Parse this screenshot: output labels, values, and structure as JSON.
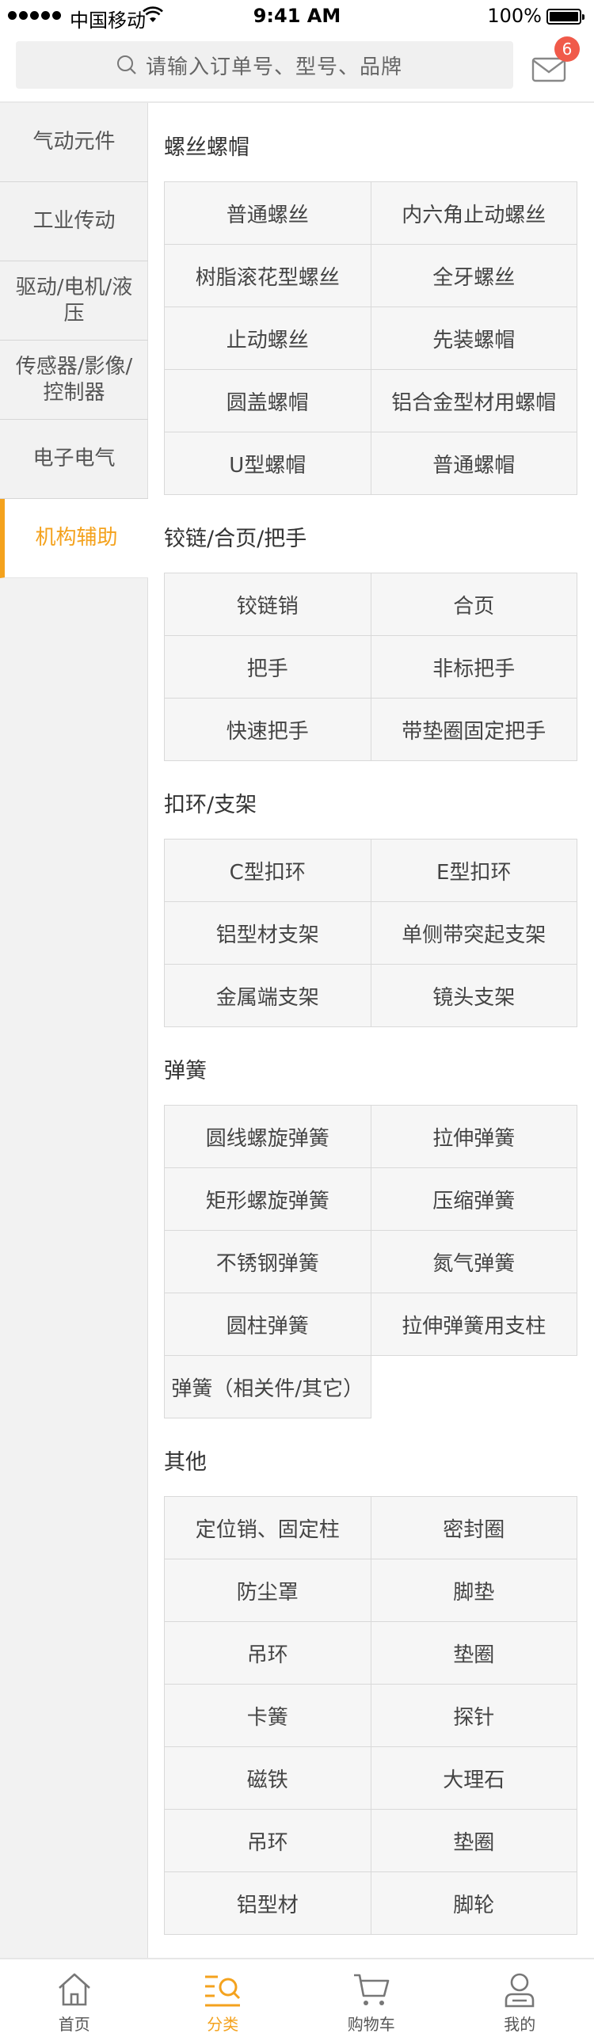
{
  "status_bar": {
    "carrier": "中国移动",
    "time": "9:41 AM",
    "battery": "100%"
  },
  "search": {
    "placeholder": "请输入订单号、型号、品牌",
    "badge_count": "6"
  },
  "sidebar": {
    "items": [
      {
        "label": "气动元件",
        "active": false
      },
      {
        "label": "工业传动",
        "active": false
      },
      {
        "label": "驱动/电机/液压",
        "active": false
      },
      {
        "label": "传感器/影像/控制器",
        "active": false
      },
      {
        "label": "电子电气",
        "active": false
      },
      {
        "label": "机构辅助",
        "active": true
      }
    ]
  },
  "sections": [
    {
      "title": "螺丝螺帽",
      "items": [
        "普通螺丝",
        "内六角止动螺丝",
        "树脂滚花型螺丝",
        "全牙螺丝",
        "止动螺丝",
        "先装螺帽",
        "圆盖螺帽",
        "铝合金型材用螺帽",
        "U型螺帽",
        "普通螺帽"
      ]
    },
    {
      "title": "铰链/合页/把手",
      "items": [
        "铰链销",
        "合页",
        "把手",
        "非标把手",
        "快速把手",
        "带垫圈固定把手"
      ]
    },
    {
      "title": "扣环/支架",
      "items": [
        "C型扣环",
        "E型扣环",
        "铝型材支架",
        "单侧带突起支架",
        "金属端支架",
        "镜头支架"
      ]
    },
    {
      "title": "弹簧",
      "items": [
        "圆线螺旋弹簧",
        "拉伸弹簧",
        "矩形螺旋弹簧",
        "压缩弹簧",
        "不锈钢弹簧",
        "氮气弹簧",
        "圆柱弹簧",
        "拉伸弹簧用支柱",
        "弹簧（相关件/其它）"
      ]
    },
    {
      "title": "其他",
      "items": [
        "定位销、固定柱",
        "密封圈",
        "防尘罩",
        "脚垫",
        "吊环",
        "垫圈",
        "卡簧",
        "探针",
        "磁铁",
        "大理石",
        "吊环",
        "垫圈",
        "铝型材",
        "脚轮"
      ]
    }
  ],
  "tabbar": {
    "items": [
      {
        "label": "首页",
        "icon": "home-icon",
        "active": false
      },
      {
        "label": "分类",
        "icon": "category-icon",
        "active": true
      },
      {
        "label": "购物车",
        "icon": "cart-icon",
        "active": false
      },
      {
        "label": "我的",
        "icon": "user-icon",
        "active": false
      }
    ]
  },
  "colors": {
    "accent": "#f4a21d",
    "badge": "#f05a4a"
  }
}
